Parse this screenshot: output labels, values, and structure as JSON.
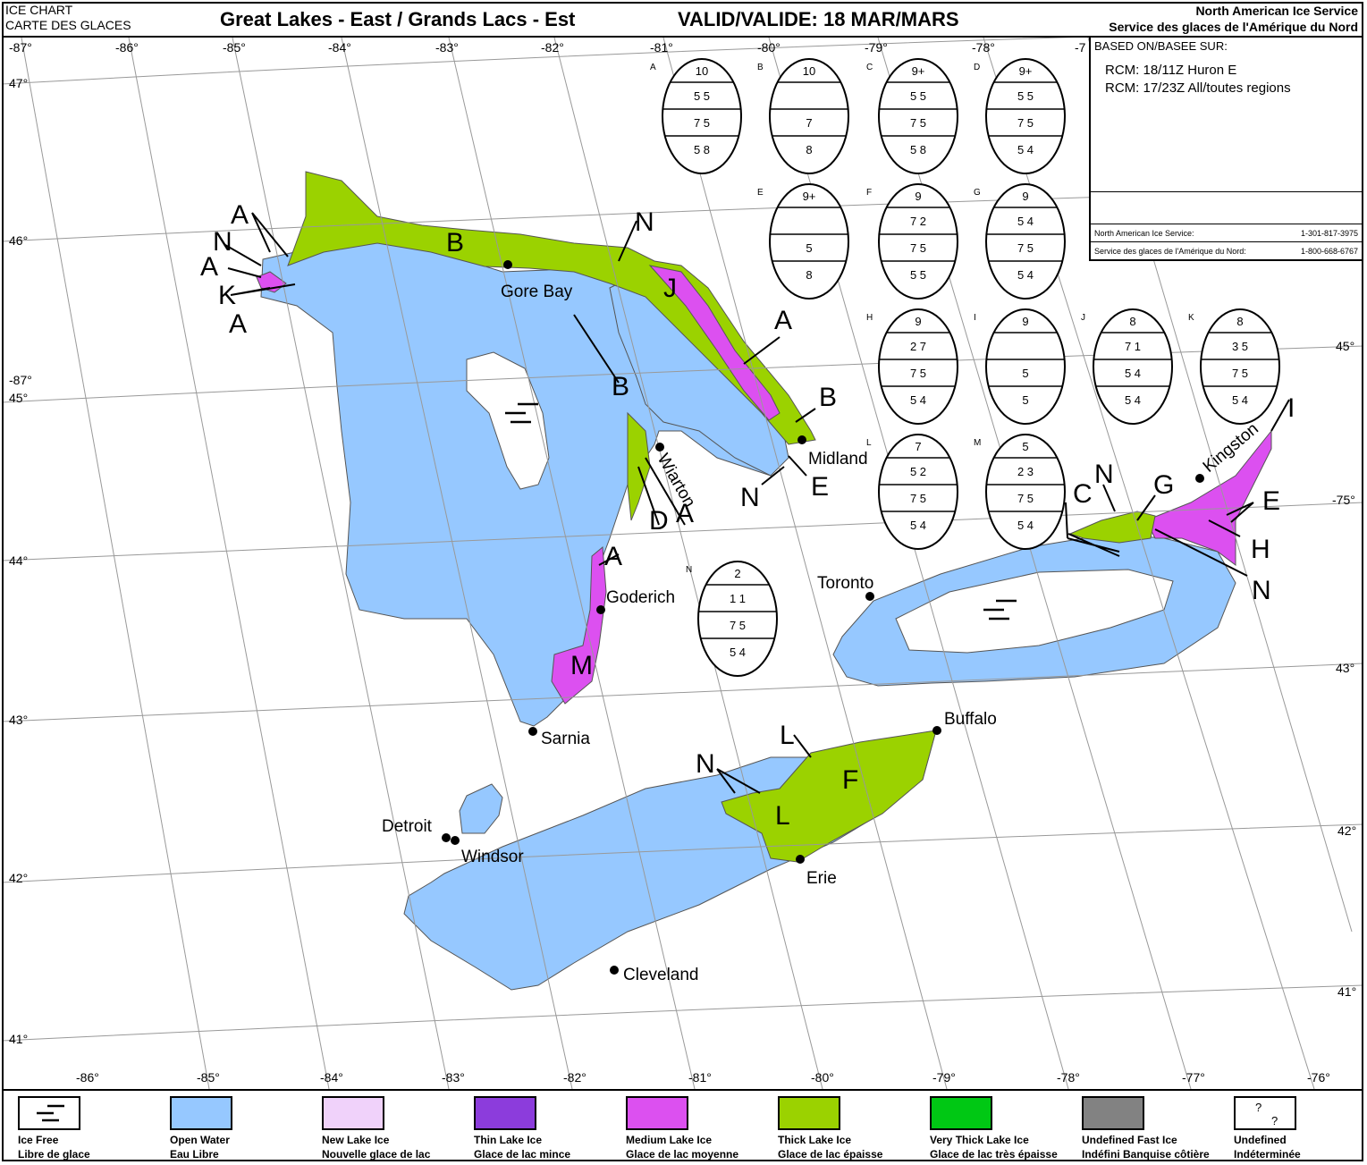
{
  "header": {
    "chart_label_en": "ICE CHART",
    "chart_label_fr": "CARTE DES GLACES",
    "region": "Great Lakes - East / Grands Lacs - Est",
    "valid": "VALID/VALIDE: 18 MAR/MARS",
    "agency_en": "North American Ice Service",
    "agency_fr": "Service des glaces de l'Amérique du Nord"
  },
  "source": {
    "title": "BASED ON/BASEE SUR:",
    "lines": [
      "RCM: 18/11Z Huron E",
      "RCM: 17/23Z All/toutes regions"
    ],
    "contact_en": "North American Ice Service:",
    "phone_en": "1-301-817-3975",
    "contact_fr": "Service des glaces de l'Amérique du Nord:",
    "phone_fr": "1-800-668-6767"
  },
  "graticule": {
    "top_lon": [
      "-87°",
      "-86°",
      "-85°",
      "-84°",
      "-83°",
      "-82°",
      "-81°",
      "-80°",
      "-79°",
      "-78°",
      "-7"
    ],
    "bottom_lon": [
      "-86°",
      "-85°",
      "-84°",
      "-83°",
      "-82°",
      "-81°",
      "-80°",
      "-79°",
      "-78°",
      "-77°",
      "-76°"
    ],
    "left_lat": [
      "47°",
      "46°",
      "-87°",
      "45°",
      "44°",
      "43°",
      "42°",
      "41°"
    ],
    "right_lat": [
      "45°",
      "-75°",
      "43°",
      "42°",
      "41°"
    ]
  },
  "cities": [
    {
      "name": "Gore Bay"
    },
    {
      "name": "Wiarton"
    },
    {
      "name": "Midland"
    },
    {
      "name": "Goderich"
    },
    {
      "name": "Toronto"
    },
    {
      "name": "Kingston"
    },
    {
      "name": "Sarnia"
    },
    {
      "name": "Detroit"
    },
    {
      "name": "Windsor"
    },
    {
      "name": "Buffalo"
    },
    {
      "name": "Erie"
    },
    {
      "name": "Cleveland"
    }
  ],
  "ice_free_symbols": 2,
  "egg_codes": [
    {
      "id": "A",
      "rows": [
        "10",
        "5  5",
        "7  5",
        "5  8"
      ]
    },
    {
      "id": "B",
      "rows": [
        "10",
        "",
        "7",
        "8"
      ]
    },
    {
      "id": "C",
      "rows": [
        "9+",
        "5  5",
        "7  5",
        "5  8"
      ]
    },
    {
      "id": "D",
      "rows": [
        "9+",
        "5  5",
        "7  5",
        "5  4"
      ]
    },
    {
      "id": "E",
      "rows": [
        "9+",
        "",
        "5",
        "8"
      ]
    },
    {
      "id": "F",
      "rows": [
        "9",
        "7  2",
        "7  5",
        "5  5"
      ]
    },
    {
      "id": "G",
      "rows": [
        "9",
        "5  4",
        "7  5",
        "5  4"
      ]
    },
    {
      "id": "H",
      "rows": [
        "9",
        "2  7",
        "7  5",
        "5  4"
      ]
    },
    {
      "id": "I",
      "rows": [
        "9",
        "",
        "5",
        "5"
      ]
    },
    {
      "id": "J",
      "rows": [
        "8",
        "7  1",
        "5  4",
        "5  4"
      ]
    },
    {
      "id": "K",
      "rows": [
        "8",
        "3  5",
        "7  5",
        "5  4"
      ]
    },
    {
      "id": "L",
      "rows": [
        "7",
        "5  2",
        "7  5",
        "5  4"
      ]
    },
    {
      "id": "M",
      "rows": [
        "5",
        "2  3",
        "7  5",
        "5  4"
      ]
    },
    {
      "id": "N",
      "rows": [
        "2",
        "1  1",
        "7  5",
        "5  4"
      ]
    }
  ],
  "region_labels": [
    "A",
    "N",
    "A",
    "K",
    "A",
    "B",
    "N",
    "J",
    "A",
    "B",
    "B",
    "N",
    "E",
    "A",
    "D",
    "A",
    "M",
    "C",
    "N",
    "G",
    "I",
    "E",
    "H",
    "N",
    "L",
    "N",
    "F",
    "L"
  ],
  "legend": [
    {
      "en": "Ice Free",
      "fr": "Libre de glace",
      "color": "#ffffff",
      "symbol": "ice-free"
    },
    {
      "en": "Open Water",
      "fr": "Eau Libre",
      "color": "#96c8ff"
    },
    {
      "en": "New Lake Ice",
      "fr": "Nouvelle glace de lac",
      "color": "#f0d2fa"
    },
    {
      "en": "Thin Lake Ice",
      "fr": "Glace de lac mince",
      "color": "#8c3cdc"
    },
    {
      "en": "Medium Lake Ice",
      "fr": "Glace de lac moyenne",
      "color": "#dc50f0"
    },
    {
      "en": "Thick Lake Ice",
      "fr": "Glace de lac épaisse",
      "color": "#9bd200"
    },
    {
      "en": "Very Thick Lake Ice",
      "fr": "Glace de lac très épaisse",
      "color": "#00c814"
    },
    {
      "en": "Undefined Fast Ice",
      "fr": "Indéfini Banquise côtière",
      "color": "#828282"
    },
    {
      "en": "Undefined",
      "fr": "Indéterminée",
      "color": "#ffffff",
      "symbol": "?"
    }
  ]
}
